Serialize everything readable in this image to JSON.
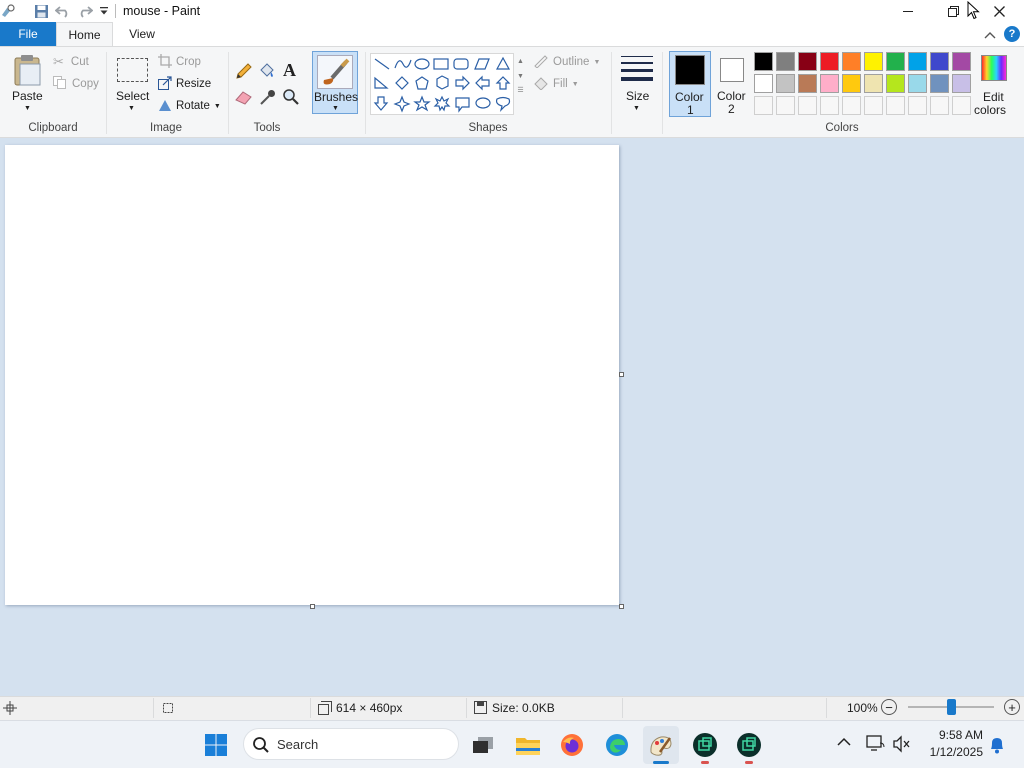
{
  "window": {
    "title": "mouse - Paint",
    "minimize_icon": "minimize-icon",
    "maximize_icon": "restore-icon",
    "close_icon": "close-icon"
  },
  "tabs": {
    "file": "File",
    "home": "Home",
    "view": "View"
  },
  "clipboard": {
    "group_label": "Clipboard",
    "paste": "Paste",
    "cut": "Cut",
    "copy": "Copy"
  },
  "image": {
    "group_label": "Image",
    "select": "Select",
    "crop": "Crop",
    "resize": "Resize",
    "rotate": "Rotate"
  },
  "tools": {
    "group_label": "Tools"
  },
  "brushes": {
    "label": "Brushes"
  },
  "shapes": {
    "group_label": "Shapes",
    "outline": "Outline",
    "fill": "Fill"
  },
  "size": {
    "label": "Size"
  },
  "colors": {
    "group_label": "Colors",
    "color1_line1": "Color",
    "color1_line2": "1",
    "color2_line1": "Color",
    "color2_line2": "2",
    "edit_line1": "Edit",
    "edit_line2": "colors",
    "color1_value": "#000000",
    "color2_value": "#ffffff",
    "palette_row1": [
      "#000000",
      "#7f7f7f",
      "#880015",
      "#ed1c24",
      "#ff7f27",
      "#fff200",
      "#22b14c",
      "#00a2e8",
      "#3f48cc",
      "#a349a4"
    ],
    "palette_row2": [
      "#ffffff",
      "#c3c3c3",
      "#b97a57",
      "#ffaec9",
      "#ffc90e",
      "#efe4b0",
      "#b5e61d",
      "#99d9ea",
      "#7092be",
      "#c8bfe7"
    ]
  },
  "status": {
    "dimensions": "614 × 460px",
    "size": "Size: 0.0KB",
    "zoom": "100%"
  },
  "taskbar": {
    "search_placeholder": "Search",
    "time": "9:58 AM",
    "date": "1/12/2025"
  }
}
